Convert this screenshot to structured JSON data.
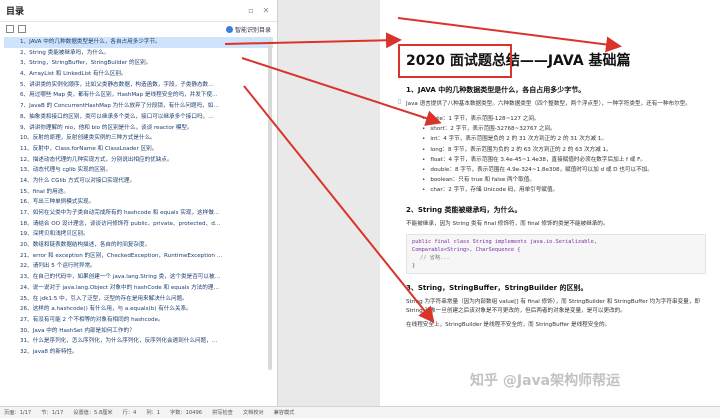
{
  "toc": {
    "title": "目录",
    "ai_button": "智能识别目录",
    "items": [
      "1、JAVA 中的几种数据类型是什么，各自占用多少字节。",
      "2、String 类能被继承吗，为什么。",
      "3、String，StringBuffer，StringBuilder 的区别。",
      "4、ArrayList 和 LinkedList 有什么区别。",
      "5、讲讲类的实例化顺序，比如父类静态数据，构造函数，字段，子类静态数…",
      "6、用过哪些 Map 类，都有什么区别，HashMap 是线程安全的吗，并发下使…",
      "7、JavaB 的 ConcurrentHashMap 为什么放弃了分段锁，有什么问题吗，如…",
      "8、抽象类和接口的区别，类可以继承多个类么，接口可以继承多个接口吗，…",
      "9、讲讲你理解的 nio，他和 bio 的区别是什么，谈谈 reactor 模型。",
      "10、反射的原理，反射创建类实例的三种方式是什么。",
      "11、反射中，Class.forName 和 ClassLoader 区别。",
      "12、描述动态代理的几种实现方式，分别说出相应的优缺点。",
      "13、动态代理与 cglib 实现的区别。",
      "14、为什么 CGlib 方式可以对接口实现代理。",
      "15、final 的用途。",
      "16、写出三种单例模式实现。",
      "17、如何在父类中为子类自动完成所有的 hashcode 和 equals 实现，这样做…",
      "18、请结合 OO 设计理念，谈谈访问修饰符 public、private、protected、d…",
      "19、深拷贝和浅拷贝区别。",
      "20、数组和链表数据结构描述，各自的时间复杂度。",
      "21、error 和 exception 的区别，CheckedException，RuntimeException …",
      "22、请列出 5 个运行时异常。",
      "23、在自己的代码中，如果创建一个 java.lang.String 类，这个类是否可以被…",
      "24、说一说对于 java.lang.Object 对象中的 hashCode 和 equals 方法的理…",
      "25、在 jdk1.5 中，引入了泛型，泛型的存在是用来解决什么问题。",
      "26、这样的 a.hashcode() 有什么用，与 a.equals(b) 有什么关系。",
      "27、有没有可能 2 个不相等的对象有相同的 hashcode。",
      "30、Java 中的 HashSet 内部是如何工作的？",
      "31、什么是序列化，怎么序列化，为什么序列化，反序列化会遇到什么问题，…",
      "32、java8 的新特性。"
    ]
  },
  "doc": {
    "title": "2020 面试题总结——JAVA 基础篇",
    "s1_heading": "1、JAVA 中的几种数据类型是什么，各自占用多少字节。",
    "s1_intro": "Java 语言提供了八种基本数据类型。六种数据类型（四个整数型，两个浮点型），一种字符类型，还有一种布尔型。",
    "s1_bullets": [
      "byte：1 字节，表示范围-128~127 之间。",
      "short：2 字节，表示范围-32768~32767 之间。",
      "int：4 字节，表示范围是负的 2 的 31 次方到正的 2 的 31 次方减 1。",
      "long：8 字节，表示范围为负的 2 的 63 次方到正的 2 的 63 次方减 1。",
      "float：4 字节，表示范围在 3.4e-45~1.4e38，直接赋值时必须在数字后加上 f 或 F。",
      "double：8 字节，表示范围在 4.9e-324~1.8e308，赋值时可以加 d 或 D 也可以不加。",
      "boolean：只有 true 和 false 两个取值。",
      "char：2 字节，存储 Unicode 码，用单引号赋值。"
    ],
    "s2_heading": "2、String 类能被继承吗，为什么。",
    "s2_text": "不能被继承，因为 String 类有 final 修饰符，而 final 修饰的类是不能被继承的。",
    "code_line1": "public final class String implements java.io.Serializable,",
    "code_line2": "Comparable<String>, CharSequence {",
    "code_comment": "// 省略...",
    "code_end": "}",
    "s3_heading": "3、String，StringBuffer，StringBuilder 的区别。",
    "s3_text": "String 为字符串常量（因为内部数组 value[] 有 final 修饰），而 StringBuilder 和 StringBuffer 均为字符串变量，即 String 对象一旦创建之后该对象是不可更改的，但后两者的对象是变量，是可以更改的。",
    "s3_text2": "在线程安全上，StringBuilder 是线程不安全的，而 StringBuffer 是线程安全的。"
  },
  "watermark": "知乎 @Java架构师帮运",
  "status": {
    "page": "页面：1/17",
    "section": "节：1/17",
    "position": "设置值：5.8厘米",
    "row": "行：4",
    "col": "列：1",
    "words": "字数：10496",
    "spell": "拼写检查",
    "doc_check": "文档校对",
    "compat": "兼容模式"
  }
}
